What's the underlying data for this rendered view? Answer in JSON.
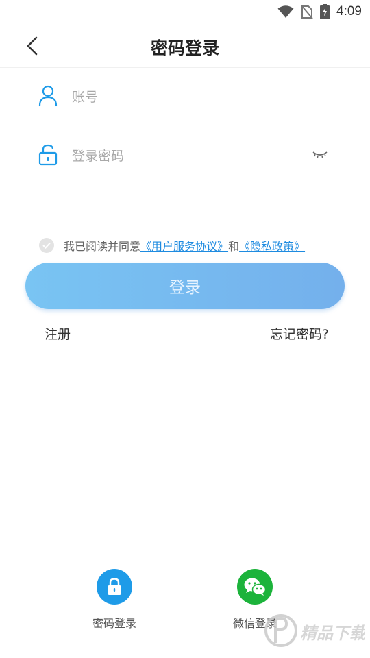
{
  "status_bar": {
    "time": "4:09"
  },
  "header": {
    "title": "密码登录"
  },
  "form": {
    "account_placeholder": "账号",
    "account_value": "",
    "password_placeholder": "登录密码",
    "password_value": ""
  },
  "agreement": {
    "prefix": "我已阅读并同意",
    "user_agreement": "《用户服务协议》",
    "and": "和",
    "privacy_policy": "《隐私政策》"
  },
  "actions": {
    "login_label": "登录",
    "register_label": "注册",
    "forgot_label": "忘记密码?"
  },
  "alt_login": {
    "password_label": "密码登录",
    "wechat_label": "微信登录"
  },
  "watermark": {
    "text": "精品下载"
  },
  "colors": {
    "accent": "#1e9be8",
    "wechat": "#1cb33b",
    "button_start": "#79c4f3",
    "button_end": "#74b0ec"
  }
}
